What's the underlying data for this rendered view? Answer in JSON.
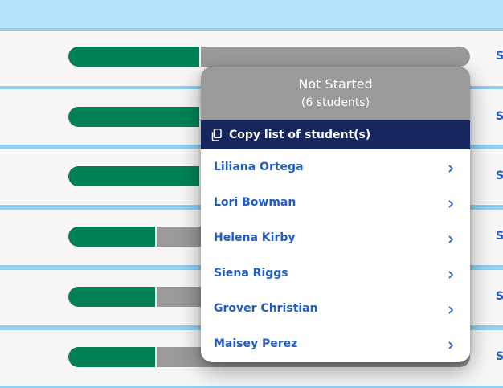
{
  "table": {
    "rows": [
      {
        "progress": 0.33,
        "link_text": "S"
      },
      {
        "progress": 0.33,
        "link_text": "S"
      },
      {
        "progress": 0.33,
        "link_text": "S"
      },
      {
        "progress": 0.22,
        "link_text": "S"
      },
      {
        "progress": 0.22,
        "link_text": "S"
      },
      {
        "progress": 0.22,
        "link_text": "S"
      }
    ]
  },
  "popover": {
    "title": "Not Started",
    "count": "(6 students)",
    "copy_label": "Copy list of student(s)",
    "copy_icon": "copy-icon",
    "students": [
      {
        "name": "Liliana Ortega"
      },
      {
        "name": "Lori Bowman"
      },
      {
        "name": "Helena Kirby"
      },
      {
        "name": "Siena Riggs"
      },
      {
        "name": "Grover Christian"
      },
      {
        "name": "Maisey Perez"
      }
    ]
  },
  "colors": {
    "complete": "#008158",
    "not_started": "#9a9a9a",
    "copy_bar": "#16265f",
    "link": "#1f5cc9",
    "divider": "#8fd0f3"
  }
}
